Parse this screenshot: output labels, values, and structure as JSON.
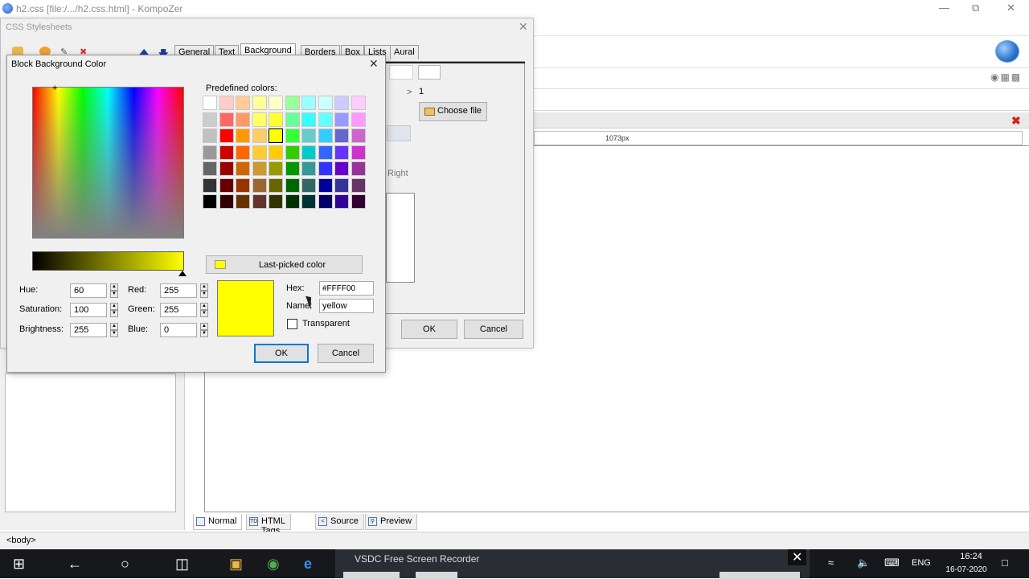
{
  "app": {
    "window_title": "h2.css [file:/.../h2.css.html] - KompoZer"
  },
  "css_dialog": {
    "title": "CSS Stylesheets",
    "tabs": [
      "General",
      "Text",
      "Background",
      "Borders",
      "Box",
      "Lists",
      "Aural"
    ],
    "selected_tab": "Background",
    "choose_file_label": "Choose file",
    "spin_value": "1",
    "right_label": "Right",
    "ok_label": "OK",
    "cancel_label": "Cancel"
  },
  "editor": {
    "ruler_label": "1073px",
    "tabs": [
      {
        "label": "Normal",
        "icon": "page-icon"
      },
      {
        "label": "HTML Tags",
        "icon": "tag-icon"
      },
      {
        "label": "Source",
        "icon": "source-icon"
      },
      {
        "label": "Preview",
        "icon": "preview-icon"
      }
    ],
    "status_text": "<body>"
  },
  "color_dialog": {
    "title": "Block Background Color",
    "predefined_label": "Predefined colors:",
    "last_picked_label": "Last-picked color",
    "hue_label": "Hue:",
    "hue_value": "60",
    "saturation_label": "Saturation:",
    "saturation_value": "100",
    "brightness_label": "Brightness:",
    "brightness_value": "255",
    "red_label": "Red:",
    "red_value": "255",
    "green_label": "Green:",
    "green_value": "255",
    "blue_label": "Blue:",
    "blue_value": "0",
    "hex_label": "Hex:",
    "hex_value": "#FFFF00",
    "name_label": "Name:",
    "name_value": "yellow",
    "transparent_label": "Transparent",
    "ok_label": "OK",
    "cancel_label": "Cancel",
    "current_color": "#ffff00",
    "palette": [
      [
        "#ffffff",
        "#ffcccc",
        "#ffcc99",
        "#ffff99",
        "#ffffcc",
        "#99ff99",
        "#99ffff",
        "#ccffff",
        "#ccccff",
        "#ffccff"
      ],
      [
        "#cccccc",
        "#ff6666",
        "#ff9966",
        "#ffff66",
        "#ffff33",
        "#66ff99",
        "#33ffff",
        "#66ffff",
        "#9999ff",
        "#ff99ff"
      ],
      [
        "#c0c0c0",
        "#ff0000",
        "#ff9900",
        "#ffcc66",
        "#ffff00",
        "#33ff33",
        "#66cccc",
        "#33ccff",
        "#6666cc",
        "#cc66cc"
      ],
      [
        "#999999",
        "#cc0000",
        "#ff6600",
        "#ffcc33",
        "#ffcc00",
        "#33cc00",
        "#00cccc",
        "#3366ff",
        "#6633ff",
        "#cc33cc"
      ],
      [
        "#666666",
        "#990000",
        "#cc6600",
        "#cc9933",
        "#999900",
        "#009900",
        "#339999",
        "#3333ff",
        "#6600cc",
        "#993399"
      ],
      [
        "#333333",
        "#660000",
        "#993300",
        "#996633",
        "#666600",
        "#006600",
        "#336666",
        "#000099",
        "#333399",
        "#663366"
      ],
      [
        "#000000",
        "#330000",
        "#663300",
        "#663333",
        "#333300",
        "#003300",
        "#003333",
        "#000066",
        "#330099",
        "#330033"
      ]
    ]
  },
  "taskbar": {
    "recorder_title": "VSDC Free Screen Recorder",
    "language": "ENG",
    "time": "16:24",
    "date": "16-07-2020"
  }
}
